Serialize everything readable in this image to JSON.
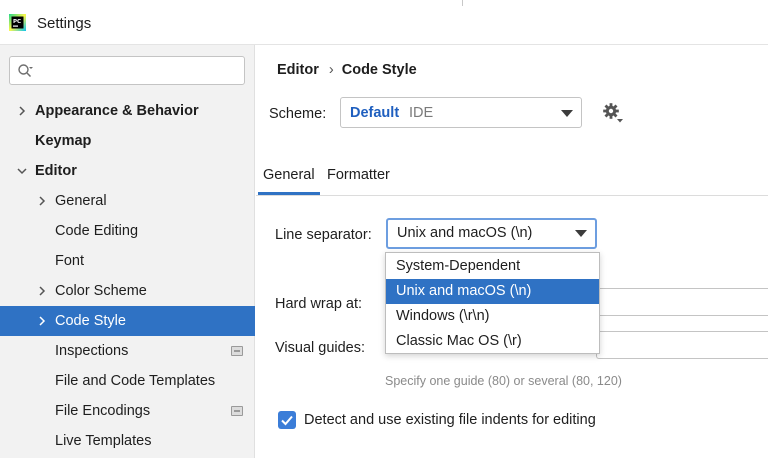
{
  "window": {
    "title": "Settings",
    "app_icon_label": "PC"
  },
  "sidebar": {
    "search_placeholder": "",
    "items": [
      {
        "label": "Appearance & Behavior",
        "bold": true,
        "expandable": true,
        "expanded": false,
        "indent": 0
      },
      {
        "label": "Keymap",
        "bold": true,
        "expandable": false,
        "indent": 0
      },
      {
        "label": "Editor",
        "bold": true,
        "expandable": true,
        "expanded": true,
        "indent": 0
      },
      {
        "label": "General",
        "expandable": true,
        "expanded": false,
        "indent": 1
      },
      {
        "label": "Code Editing",
        "indent": 1
      },
      {
        "label": "Font",
        "indent": 1
      },
      {
        "label": "Color Scheme",
        "expandable": true,
        "expanded": false,
        "indent": 1
      },
      {
        "label": "Code Style",
        "expandable": true,
        "expanded": false,
        "selected": true,
        "indent": 1
      },
      {
        "label": "Inspections",
        "indent": 1,
        "project_icon": true
      },
      {
        "label": "File and Code Templates",
        "indent": 1
      },
      {
        "label": "File Encodings",
        "indent": 1,
        "project_icon": true
      },
      {
        "label": "Live Templates",
        "indent": 1
      }
    ]
  },
  "main": {
    "breadcrumb": [
      "Editor",
      "Code Style"
    ],
    "breadcrumb_separator": "›",
    "scheme": {
      "label": "Scheme:",
      "name": "Default",
      "kind": "IDE"
    },
    "tabs": [
      {
        "label": "General",
        "active": true
      },
      {
        "label": "Formatter",
        "active": false
      }
    ],
    "line_separator": {
      "label": "Line separator:",
      "value": "Unix and macOS (\\n)",
      "options": [
        "System-Dependent",
        "Unix and macOS (\\n)",
        "Windows (\\r\\n)",
        "Classic Mac OS (\\r)"
      ],
      "highlighted_index": 1
    },
    "hard_wrap": {
      "label": "Hard wrap at:"
    },
    "visual_guides": {
      "label": "Visual guides:",
      "hint": "Specify one guide (80) or several (80, 120)"
    },
    "detect_indents": {
      "label": "Detect and use existing file indents for editing",
      "checked": true
    }
  },
  "colors": {
    "accent": "#2f72c4",
    "link_blue": "#1f5fbf",
    "sidebar_bg": "#f2f2f2"
  }
}
